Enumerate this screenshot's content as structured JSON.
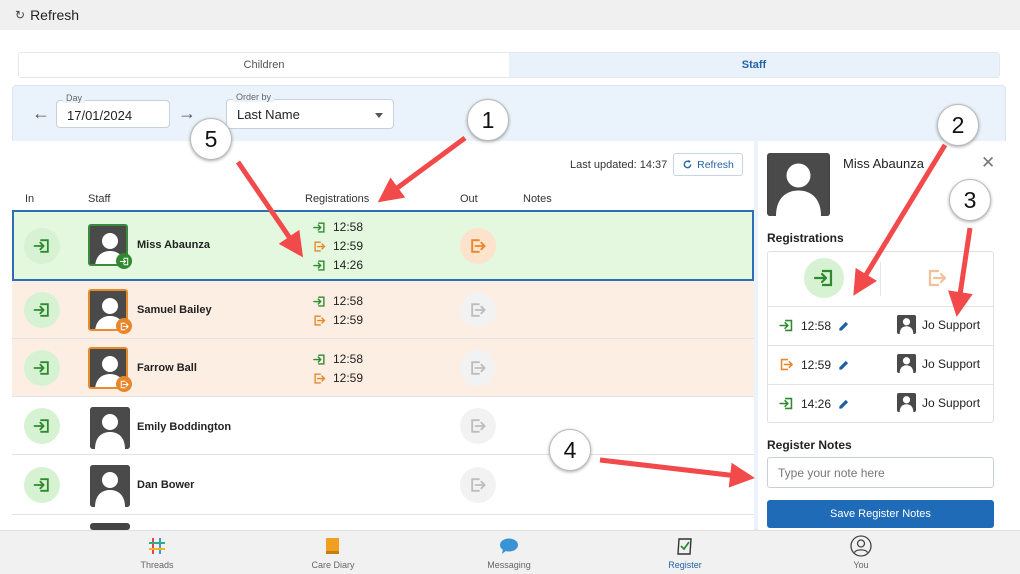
{
  "topbar": {
    "refresh_icon": "↻",
    "refresh_label": "Refresh"
  },
  "tabs": [
    {
      "label": "Children",
      "active": false
    },
    {
      "label": "Staff",
      "active": true
    }
  ],
  "filters": {
    "day_label": "Day",
    "day_value": "17/01/2024",
    "order_label": "Order by",
    "order_value": "Last Name"
  },
  "status": {
    "last_updated": "Last updated: 14:37",
    "refresh_label": "Refresh"
  },
  "table": {
    "headers": {
      "in": "In",
      "staff": "Staff",
      "registrations": "Registrations",
      "out": "Out",
      "notes": "Notes"
    },
    "rows": [
      {
        "name": "Miss Abaunza",
        "state": "signed-in",
        "registrations": [
          {
            "type": "in",
            "time": "12:58"
          },
          {
            "type": "out",
            "time": "12:59"
          },
          {
            "type": "in",
            "time": "14:26"
          }
        ]
      },
      {
        "name": "Samuel Bailey",
        "state": "signed-out",
        "registrations": [
          {
            "type": "in",
            "time": "12:58"
          },
          {
            "type": "out",
            "time": "12:59"
          }
        ]
      },
      {
        "name": "Farrow Ball",
        "state": "signed-out",
        "registrations": [
          {
            "type": "in",
            "time": "12:58"
          },
          {
            "type": "out",
            "time": "12:59"
          }
        ]
      },
      {
        "name": "Emily Boddington",
        "state": "none",
        "registrations": []
      },
      {
        "name": "Dan Bower",
        "state": "none",
        "registrations": []
      }
    ]
  },
  "side_panel": {
    "name": "Miss Abaunza",
    "registrations_title": "Registrations",
    "entries": [
      {
        "type": "in",
        "time": "12:58",
        "user": "Jo Support"
      },
      {
        "type": "out",
        "time": "12:59",
        "user": "Jo Support"
      },
      {
        "type": "in",
        "time": "14:26",
        "user": "Jo Support"
      }
    ],
    "notes_title": "Register Notes",
    "notes_placeholder": "Type your note here",
    "save_label": "Save Register Notes"
  },
  "bottom_nav": [
    {
      "label": "Threads",
      "icon": "threads-icon"
    },
    {
      "label": "Care Diary",
      "icon": "book-icon"
    },
    {
      "label": "Messaging",
      "icon": "chat-bubble-icon"
    },
    {
      "label": "Register",
      "icon": "register-icon",
      "active": true
    },
    {
      "label": "You",
      "icon": "user-circle-icon"
    }
  ],
  "callouts": [
    "1",
    "2",
    "3",
    "4",
    "5"
  ],
  "colors": {
    "green": "#2f8a2f",
    "orange": "#e8862a",
    "accent": "#1f6bb8",
    "annotation": "#f2494a"
  }
}
